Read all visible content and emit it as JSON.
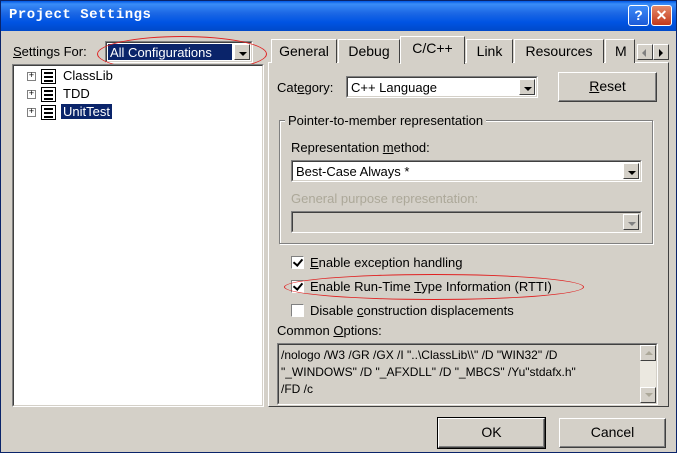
{
  "window": {
    "title": "Project Settings",
    "help_label": "?",
    "close_label": "✕"
  },
  "settings_for": {
    "label_pre": "",
    "label_u": "S",
    "label_post": "ettings For:",
    "value": "All Configurations"
  },
  "tree": {
    "items": [
      {
        "expander": "+",
        "label": "ClassLib"
      },
      {
        "expander": "+",
        "label": "TDD"
      },
      {
        "expander": "+",
        "label": "UnitTest"
      }
    ]
  },
  "tabs": [
    {
      "label": "General"
    },
    {
      "label": "Debug"
    },
    {
      "label": "C/C++"
    },
    {
      "label": "Link"
    },
    {
      "label": "Resources"
    },
    {
      "label": "M"
    }
  ],
  "category": {
    "label_pre": "Cat",
    "label_u": "e",
    "label_post": "gory:",
    "value": "C++ Language"
  },
  "reset": {
    "label_u": "R",
    "label_post": "eset"
  },
  "ptm_group": {
    "title": "Pointer-to-member representation",
    "method_label_pre": "Representation ",
    "method_label_u": "m",
    "method_label_post": "ethod:",
    "method_value": "Best-Case Always *",
    "general_purpose_label": "General purpose representation:",
    "general_purpose_value": ""
  },
  "options": {
    "exception_pre": "",
    "exception_u": "E",
    "exception_post": "nable exception handling",
    "exception_checked": true,
    "rtti_pre": "Enable Run-Time ",
    "rtti_u": "T",
    "rtti_post": "ype Information (RTTI)",
    "rtti_checked": true,
    "disable_pre": "Disable ",
    "disable_u": "c",
    "disable_post": "onstruction displacements",
    "disable_checked": false
  },
  "common_options": {
    "label_pre": "Common ",
    "label_u": "O",
    "label_post": "ptions:",
    "lines": [
      "/nologo /W3 /GR /GX /I \"..\\ClassLib\\\\\" /D \"WIN32\" /D",
      "\"_WINDOWS\" /D \"_AFXDLL\" /D \"_MBCS\" /Yu\"stdafx.h\"",
      "/FD /c"
    ]
  },
  "buttons": {
    "ok": "OK",
    "cancel": "Cancel"
  },
  "colors": {
    "title_bar": "#0054e3",
    "highlight": "#0a246a",
    "annotation": "#e02020"
  }
}
